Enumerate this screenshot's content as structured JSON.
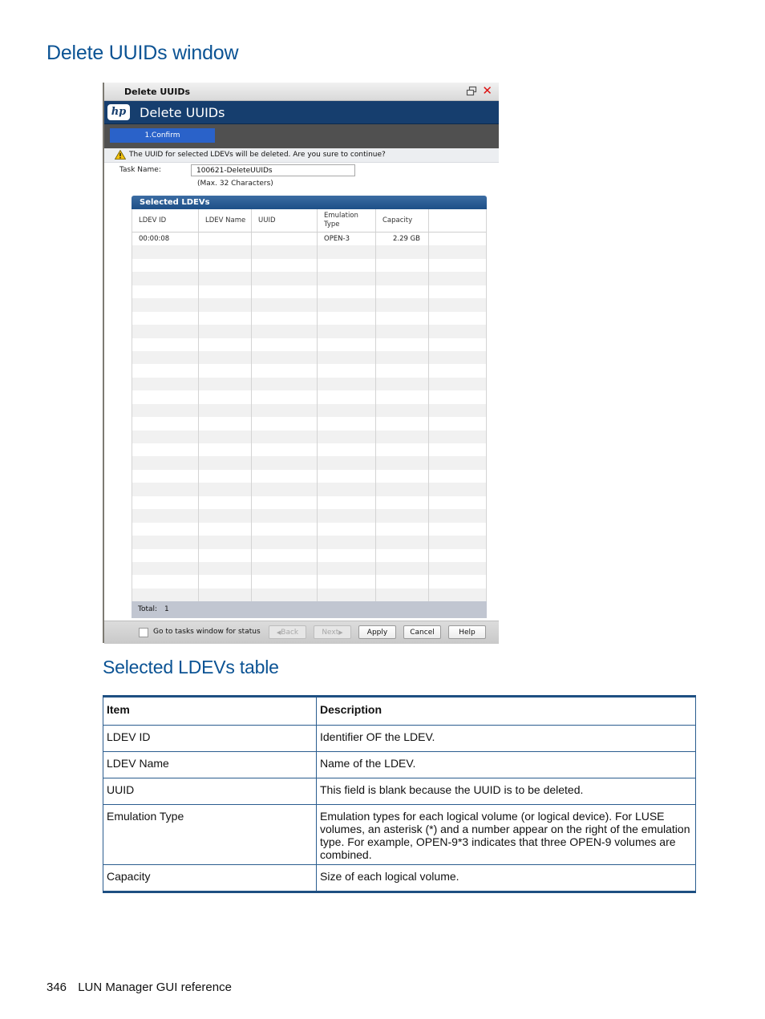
{
  "page": {
    "section_title": "Delete UUIDs window",
    "subsection_title": "Selected LDEVs table",
    "footer": {
      "page_number": "346",
      "text": "LUN Manager GUI reference"
    }
  },
  "window": {
    "title": "Delete UUIDs",
    "banner_title": "Delete UUIDs",
    "logo_text": "hp",
    "step": "1.Confirm",
    "warning": "The UUID for selected LDEVs will be deleted. Are you sure to continue?",
    "task_name_label": "Task Name:",
    "task_name_value": "100621-DeleteUUIDs",
    "task_name_hint": "(Max. 32 Characters)",
    "grid": {
      "title": "Selected LDEVs",
      "columns": [
        "LDEV ID",
        "LDEV Name",
        "UUID",
        "Emulation Type",
        "Capacity",
        ""
      ],
      "rows": [
        [
          "00:00:08",
          "",
          "",
          "OPEN-3",
          "2.29 GB",
          ""
        ]
      ],
      "total_label": "Total:",
      "total_value": "1"
    },
    "footer": {
      "checkbox_label": "Go to tasks window for status",
      "checkbox_checked": false,
      "buttons": {
        "back": "Back",
        "next": "Next",
        "apply": "Apply",
        "cancel": "Cancel",
        "help": "Help"
      }
    }
  },
  "doc_table": {
    "headers": [
      "Item",
      "Description"
    ],
    "rows": [
      {
        "item": "LDEV ID",
        "description": "Identifier OF the LDEV."
      },
      {
        "item": "LDEV Name",
        "description": "Name of the LDEV."
      },
      {
        "item": "UUID",
        "description": "This field is blank because the UUID is to be deleted."
      },
      {
        "item": "Emulation Type",
        "description": "Emulation types for each logical volume (or logical device). For LUSE volumes, an asterisk (*) and a number appear on the right of the emulation type. For example, OPEN-9*3 indicates that three OPEN-9 volumes are combined."
      },
      {
        "item": "Capacity",
        "description": "Size of each logical volume."
      }
    ]
  }
}
